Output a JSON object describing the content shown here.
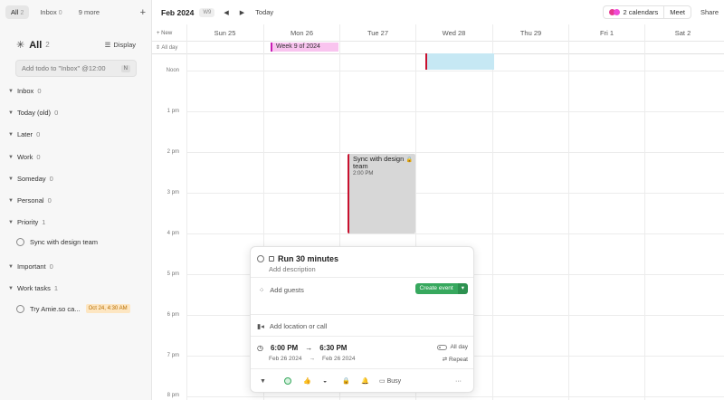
{
  "sidebar": {
    "tabs": [
      {
        "label": "All",
        "count": "2"
      },
      {
        "label": "Inbox",
        "count": "0"
      },
      {
        "label": "9 more",
        "count": ""
      }
    ],
    "title": "All",
    "title_count": "2",
    "display_label": "Display",
    "input_placeholder": "Add todo to \"Inbox\" @12:00",
    "input_key": "N",
    "groups": [
      {
        "label": "Inbox",
        "count": "0"
      },
      {
        "label": "Today (old)",
        "count": "0"
      },
      {
        "label": "Later",
        "count": "0"
      },
      {
        "label": "Work",
        "count": "0"
      },
      {
        "label": "Someday",
        "count": "0"
      },
      {
        "label": "Personal",
        "count": "0"
      },
      {
        "label": "Priority",
        "count": "1"
      },
      {
        "label": "Important",
        "count": "0"
      },
      {
        "label": "Work tasks",
        "count": "1"
      }
    ],
    "tasks": [
      {
        "label": "Sync with design team",
        "badge": ""
      },
      {
        "label": "Try Amie.so ca...",
        "badge": "Oct 24, 4:30 AM"
      }
    ]
  },
  "header": {
    "month": "Feb 2024",
    "week": "W9",
    "today": "Today",
    "calendars_label": "2 calendars",
    "meet": "Meet",
    "share": "Share",
    "calendar_colors": [
      "#e6388f",
      "#f04bd6"
    ]
  },
  "days": [
    "Sun 25",
    "Mon 26",
    "Tue 27",
    "Wed 28",
    "Thu 29",
    "Fri  1",
    "Sat  2"
  ],
  "new_label": "+ New",
  "allday_label": "All day",
  "week_event": "Week 9 of 2024",
  "times": [
    "Noon",
    "1 pm",
    "2 pm",
    "3 pm",
    "4 pm",
    "5 pm",
    "6 pm",
    "7 pm",
    "8 pm"
  ],
  "event": {
    "title": "Sync with design team",
    "time": "2:00 PM"
  },
  "popup": {
    "title": "Run 30 minutes",
    "description": "Add description",
    "guests": "Add guests",
    "create": "Create event",
    "location": "Add location or call",
    "start": "6:00 PM",
    "end": "6:30 PM",
    "start_date": "Feb 26 2024",
    "end_date": "Feb 26 2024",
    "allday": "All day",
    "repeat": "Repeat",
    "busy": "Busy"
  }
}
